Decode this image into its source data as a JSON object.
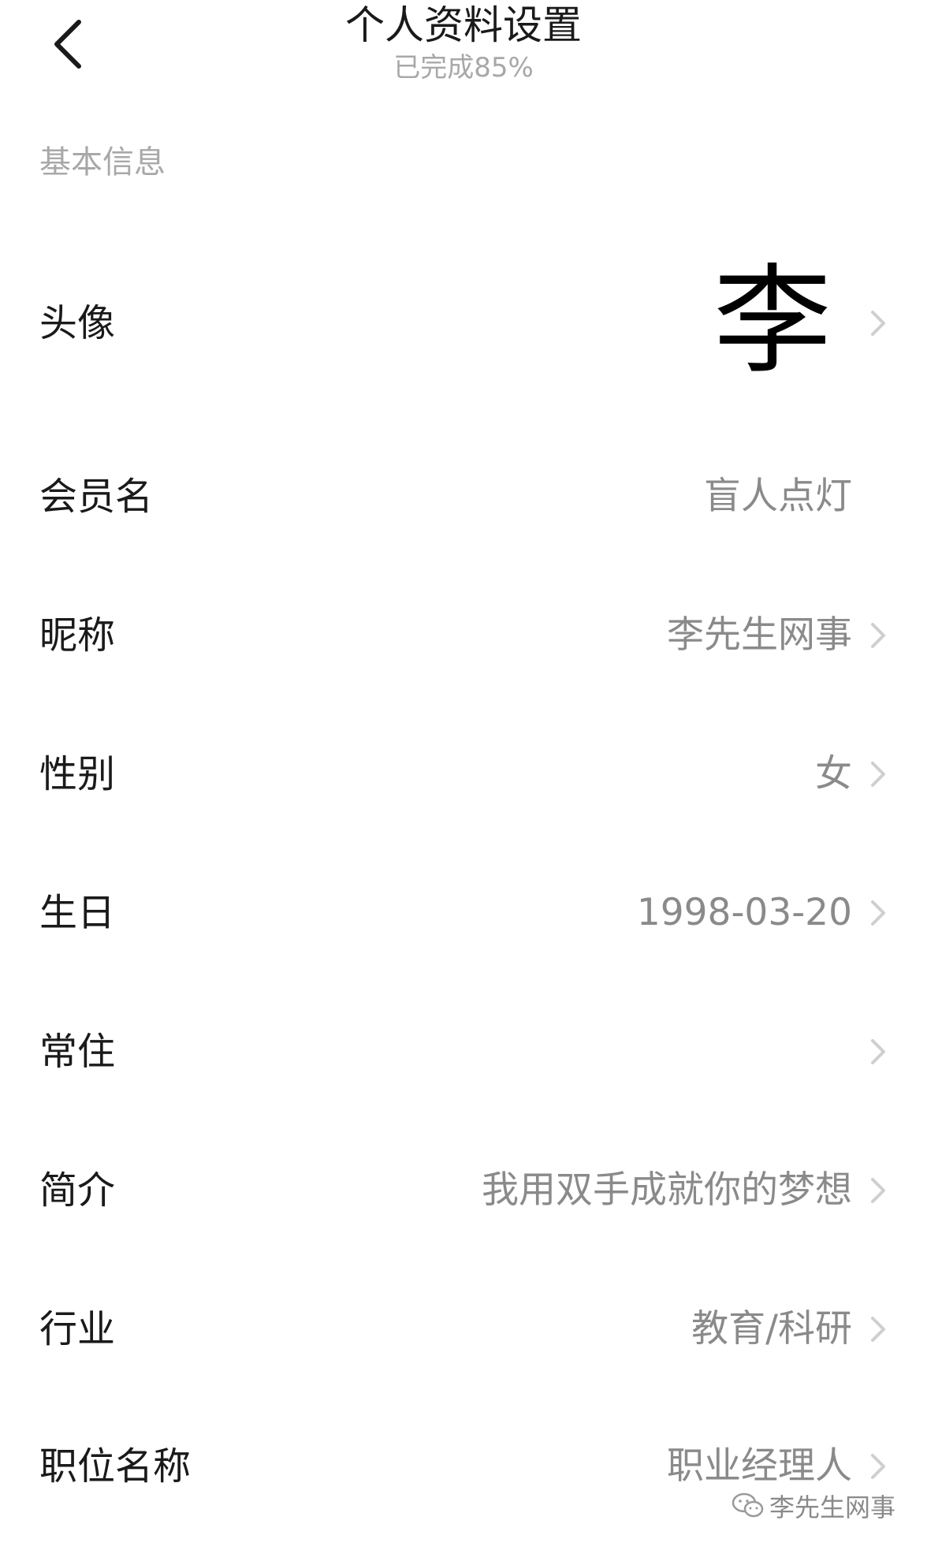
{
  "header": {
    "title": "个人资料设置",
    "subtitle": "已完成85%",
    "back_icon": "chevron-left-icon"
  },
  "section": {
    "title": "基本信息"
  },
  "rows": {
    "avatar": {
      "label": "头像",
      "value": "李",
      "has_chevron": true
    },
    "member_name": {
      "label": "会员名",
      "value": "盲人点灯",
      "has_chevron": false
    },
    "nickname": {
      "label": "昵称",
      "value": "李先生网事",
      "has_chevron": true
    },
    "gender": {
      "label": "性别",
      "value": "女",
      "has_chevron": true
    },
    "birthday": {
      "label": "生日",
      "value": "1998-03-20",
      "has_chevron": true
    },
    "residence": {
      "label": "常住",
      "value": "",
      "has_chevron": true
    },
    "bio": {
      "label": "简介",
      "value": "我用双手成就你的梦想",
      "has_chevron": true
    },
    "industry": {
      "label": "行业",
      "value": "教育/科研",
      "has_chevron": true
    },
    "job_title": {
      "label": "职位名称",
      "value": "职业经理人",
      "has_chevron": true
    }
  },
  "watermark": {
    "icon": "wechat-icon",
    "text": "李先生网事"
  },
  "colors": {
    "text_primary": "#1a1a1a",
    "text_secondary": "#8a8a8a",
    "text_muted": "#a8a8a8",
    "chevron": "#cfcfcf",
    "background": "#ffffff"
  }
}
